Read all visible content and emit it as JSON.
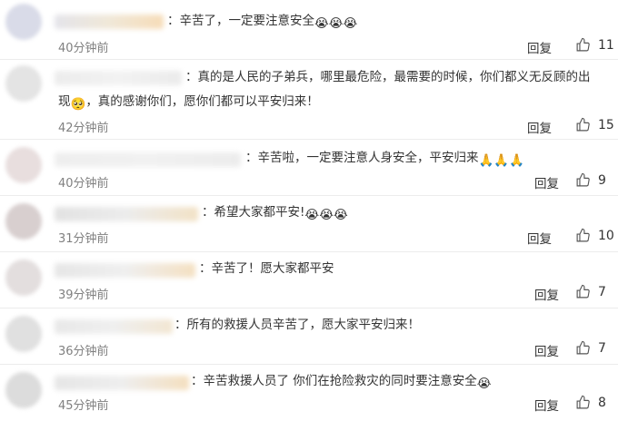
{
  "comments": [
    {
      "text": "：辛苦了，一定要注意安全",
      "emoji": "😭😭😭",
      "time": "40分钟前",
      "reply": "回复",
      "likes": "11"
    },
    {
      "text1": "：真的是人民的子弟兵，哪里最危险，最需要的时候，你们都义无反顾的出",
      "text2": "现",
      "emoji": "🥺",
      "text3": "，真的感谢你们，愿你们都可以平安归来！",
      "time": "42分钟前",
      "reply": "回复",
      "likes": "15"
    },
    {
      "text": "：辛苦啦，一定要注意人身安全，平安归来",
      "emoji": "🙏🙏🙏",
      "time": "40分钟前",
      "reply": "回复",
      "likes": "9"
    },
    {
      "text": "：希望大家都平安!",
      "emoji": "😭😭😭",
      "time": "31分钟前",
      "reply": "回复",
      "likes": "10"
    },
    {
      "text": "：辛苦了！愿大家都平安",
      "time": "39分钟前",
      "reply": "回复",
      "likes": "7"
    },
    {
      "text": "：所有的救援人员辛苦了，愿大家平安归来！",
      "time": "36分钟前",
      "reply": "回复",
      "likes": "7"
    },
    {
      "text": "：辛苦救援人员了 你们在抢险救灾的同时要注意安全",
      "emoji": "😭",
      "time": "45分钟前",
      "reply": "回复",
      "likes": "8"
    }
  ],
  "icons": {
    "like": "thumbs-up-icon"
  },
  "colors": {
    "text": "#333333",
    "time": "#808080",
    "divider": "#ececec"
  }
}
